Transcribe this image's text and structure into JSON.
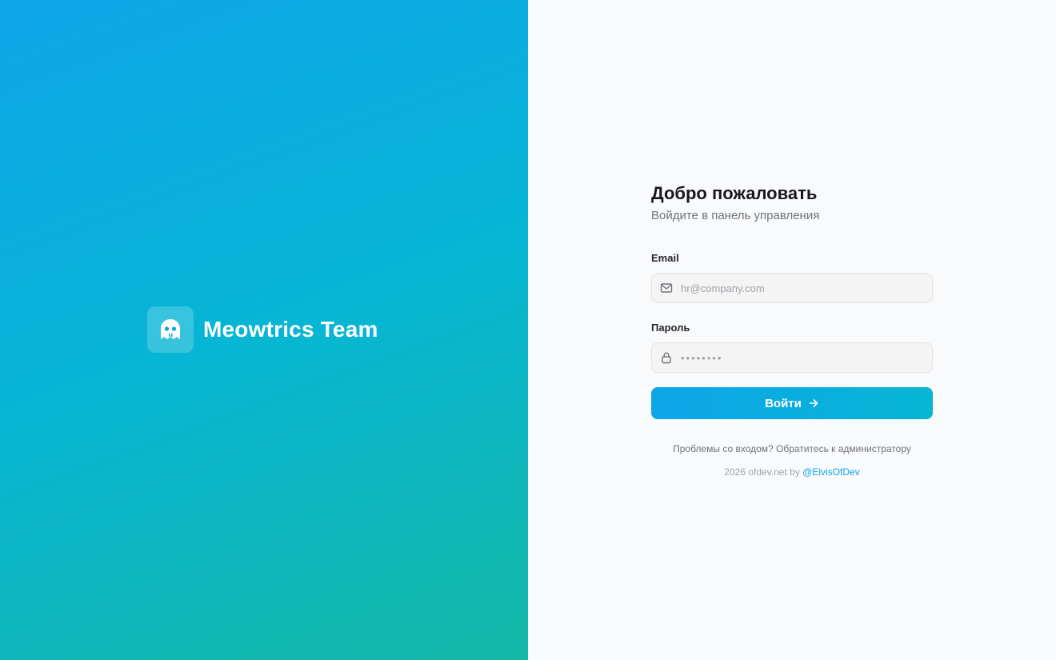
{
  "brand": {
    "name": "Meowtrics Team",
    "logo_icon": "ghost-icon"
  },
  "colors": {
    "gradient_start": "#0ea5e9",
    "gradient_mid": "#06b6d4",
    "gradient_end": "#14b8a6",
    "accent": "#0ea5e9"
  },
  "login": {
    "title": "Добро пожаловать",
    "subtitle": "Войдите в панель управления",
    "email": {
      "label": "Email",
      "icon": "mail-icon",
      "value": "",
      "placeholder": "hr@company.com"
    },
    "password": {
      "label": "Пароль",
      "icon": "lock-icon",
      "value": "",
      "placeholder": "••••••••"
    },
    "submit_label": "Войти",
    "submit_icon": "arrow-right-icon",
    "help_text": "Проблемы со входом? Обратитесь к администратору"
  },
  "footer": {
    "prefix": "2026 ofdev.net by",
    "author_link": "@ElvisOfDev"
  }
}
